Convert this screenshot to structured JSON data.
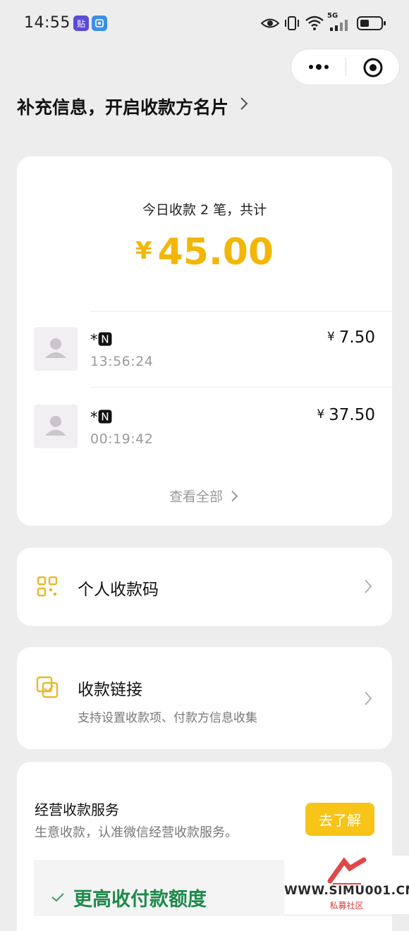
{
  "status_bar": {
    "time": "14:55",
    "app_icons": [
      "贴",
      "app-icon"
    ],
    "indicators": [
      "eye-icon",
      "vibrate-icon",
      "wifi-icon",
      "5g-signal-icon",
      "battery-icon"
    ],
    "network": "5G"
  },
  "capsule": {
    "more_icon": "more-dots-icon",
    "close_icon": "target-circle-icon"
  },
  "header": {
    "title": "补充信息，开启收款方名片"
  },
  "summary": {
    "label": "今日收款 2 笔，共计",
    "currency": "¥",
    "total": "45.00",
    "accent_color": "#f2b705",
    "transactions": [
      {
        "name": "*🅽",
        "time": "13:56:24",
        "currency": "¥",
        "amount": "7.50"
      },
      {
        "name": "*🅽",
        "time": "00:19:42",
        "currency": "¥",
        "amount": "37.50"
      }
    ],
    "view_all": "查看全部"
  },
  "menu": {
    "qr": {
      "label": "个人收款码",
      "icon": "qr-code-icon"
    },
    "link": {
      "label": "收款链接",
      "sub": "支持设置收款项、付款方信息收集",
      "icon": "payment-link-icon"
    }
  },
  "business": {
    "title": "经营收款服务",
    "subtitle": "生意收款，认准微信经营收款服务。",
    "button": "去了解",
    "button_color": "#f7c417",
    "feature": "更高收付款额度"
  },
  "watermark": {
    "text": "WWW.SIMU001.CN",
    "sub": "私募社区"
  }
}
